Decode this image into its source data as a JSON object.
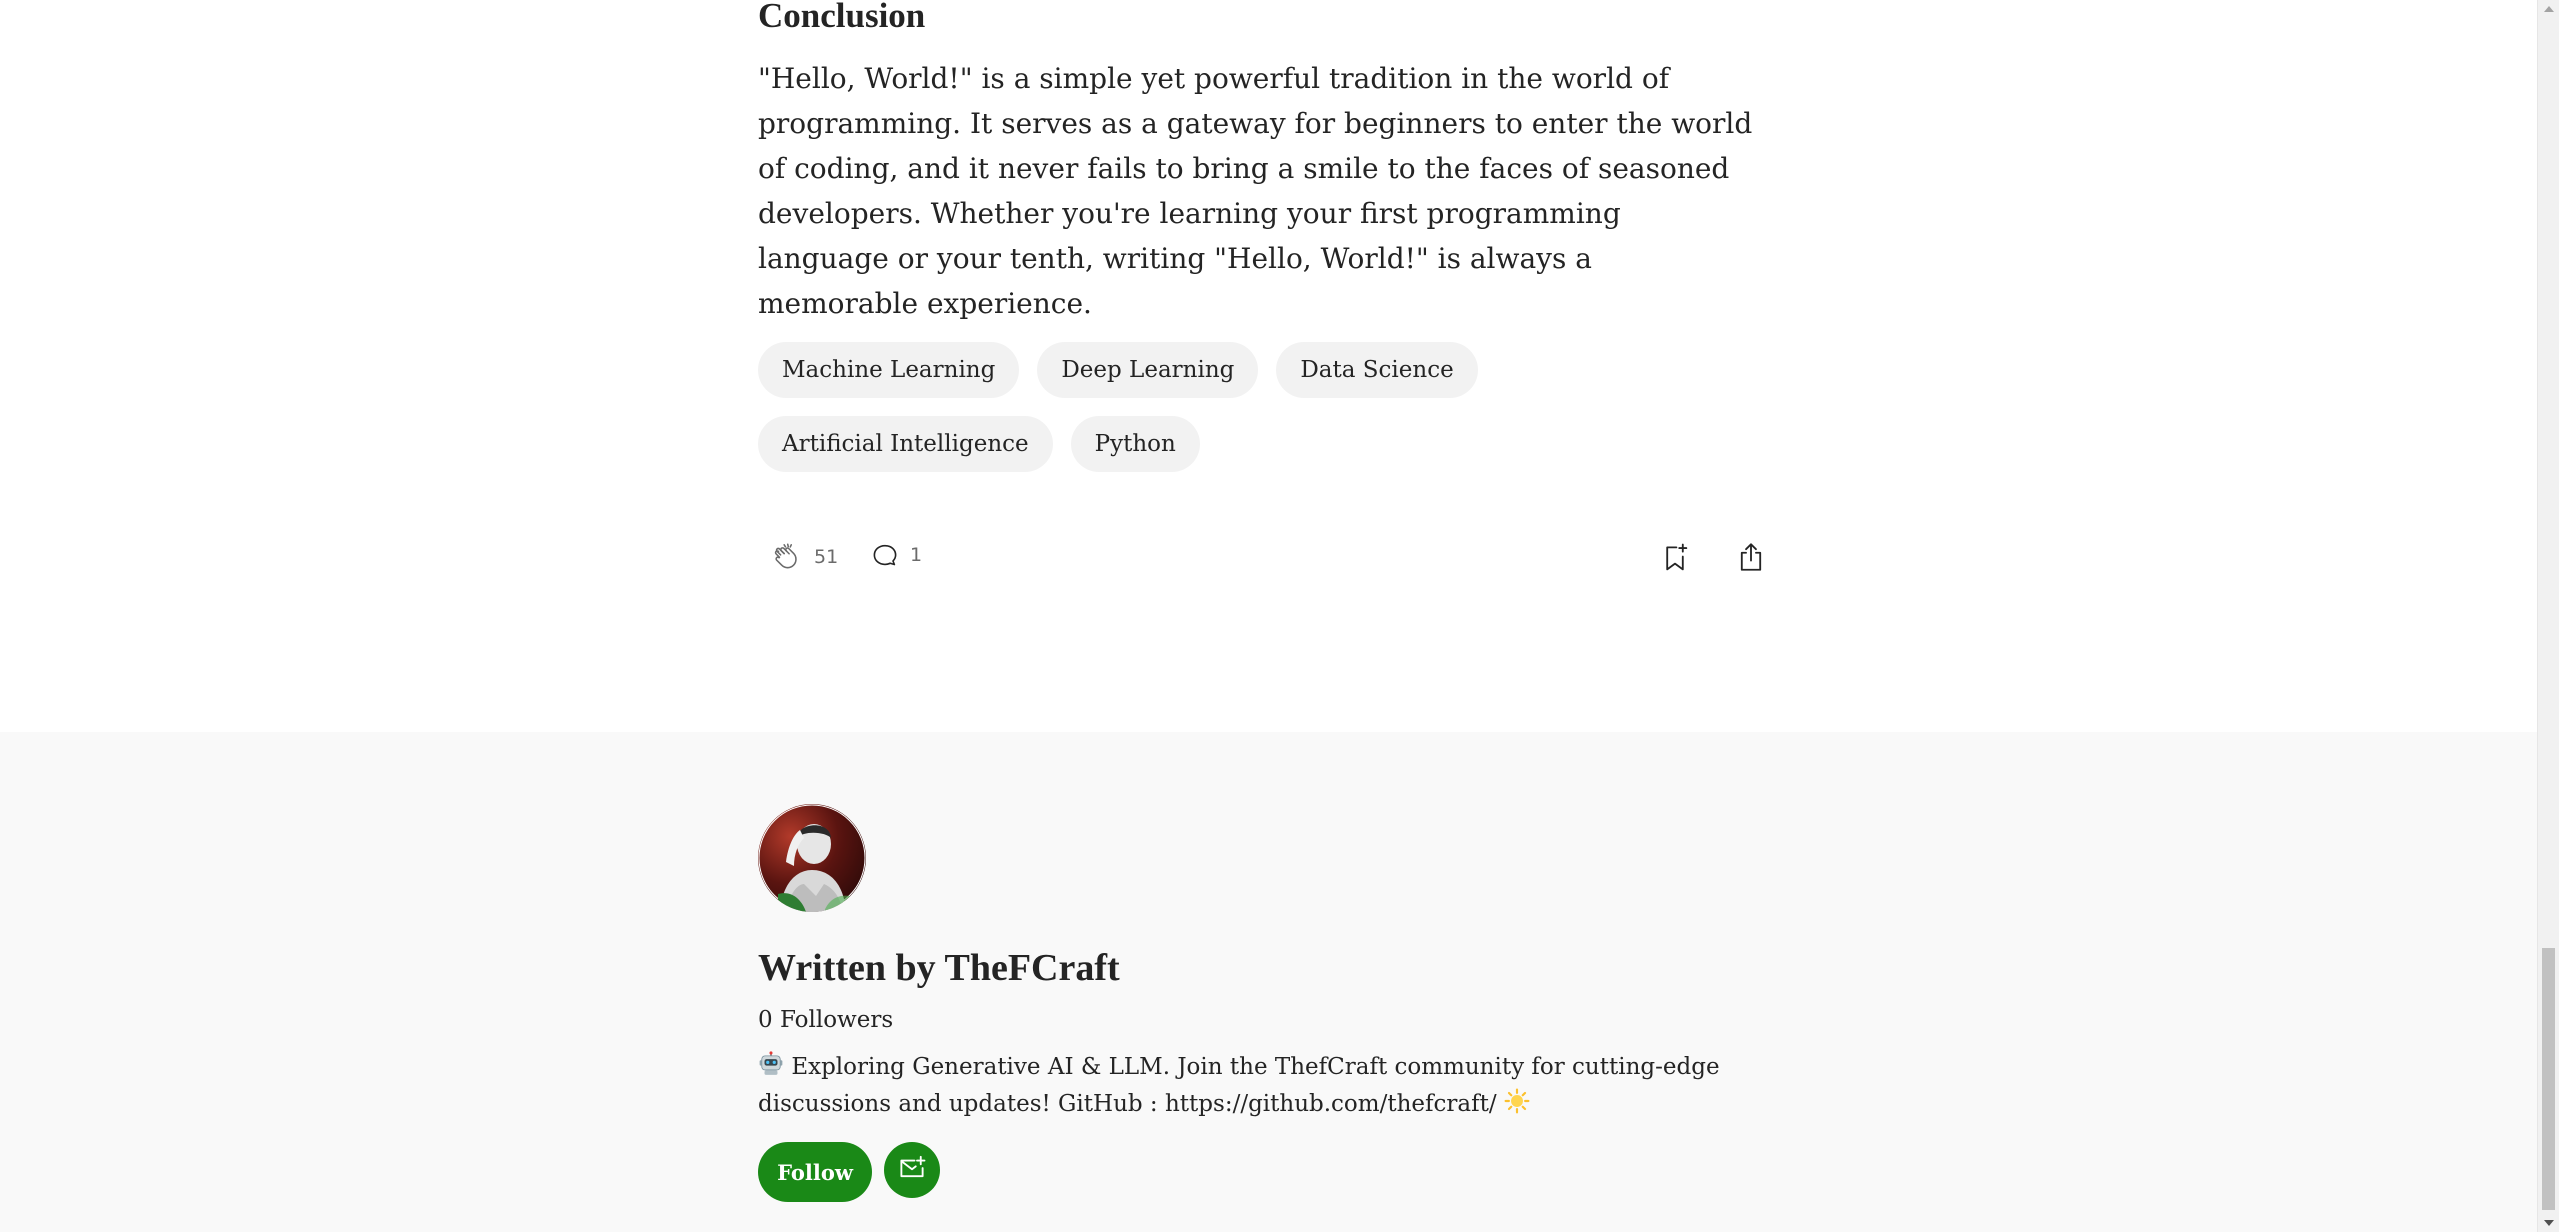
{
  "article": {
    "heading": "Conclusion",
    "paragraph": "\"Hello, World!\" is a simple yet powerful tradition in the world of programming. It serves as a gateway for beginners to enter the world of coding, and it never fails to bring a smile to the faces of seasoned developers. Whether you're learning your first programming language or your tenth, writing \"Hello, World!\" is always a memorable experience.",
    "tags": [
      "Machine Learning",
      "Deep Learning",
      "Data Science",
      "Artificial Intelligence",
      "Python"
    ],
    "claps": "51",
    "responses": "1",
    "icons": {
      "clap": "clap-icon",
      "response": "comment-icon",
      "save": "bookmark-add-icon",
      "share": "share-icon"
    }
  },
  "author": {
    "written_by": "Written by TheFCraft",
    "followers": "0 Followers",
    "bio_prefix_emoji": "robot-emoji",
    "bio": "Exploring Generative AI & LLM. Join the ThefCraft community for cutting-edge discussions and updates! GitHub : https://github.com/thefcraft/",
    "bio_suffix_emoji": "sun-emoji",
    "follow_label": "Follow",
    "subscribe_icon": "mail-plus-icon"
  },
  "colors": {
    "accent_green": "#1a8917",
    "footer_bg": "#f9f9f9",
    "tag_bg": "#f2f2f2",
    "text": "#242424",
    "muted": "#6b6b6b"
  }
}
